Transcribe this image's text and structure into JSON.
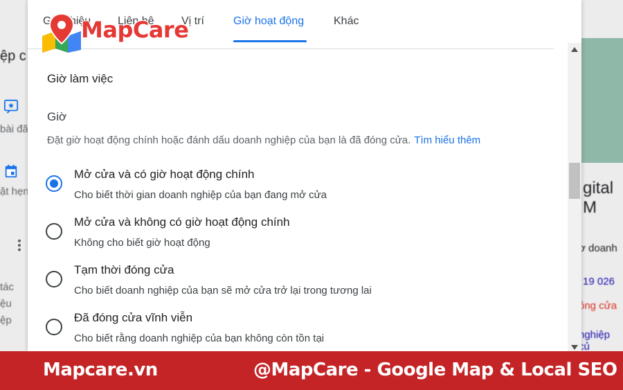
{
  "background_page": {
    "heading": "ệp c",
    "item_1": "bài đă",
    "item_2": "ặt hẹn",
    "item_3": "tác\nệu\nệp",
    "right_title": "gital M",
    "right_line_1": "ơ doanh",
    "right_phone": "19 026",
    "right_status": "ông cửa",
    "right_link": "nghiệp củ"
  },
  "brand": {
    "logo_text": "MapCare",
    "accent_color": "#e53935"
  },
  "dialog": {
    "tabs": [
      {
        "label": "Giới thiệu",
        "active": false
      },
      {
        "label": "Liên hệ",
        "active": false
      },
      {
        "label": "Vị trí",
        "active": false
      },
      {
        "label": "Giờ hoạt động",
        "active": true
      },
      {
        "label": "Khác",
        "active": false
      }
    ],
    "section_title": "Giờ làm việc",
    "hours_label": "Giờ",
    "description": "Đặt giờ hoạt động chính hoặc đánh dấu doanh nghiệp của bạn là đã đóng cửa.",
    "learn_more": "Tìm hiểu thêm",
    "options": [
      {
        "title": "Mở cửa và có giờ hoạt động chính",
        "subtitle": "Cho biết thời gian doanh nghiệp của bạn đang mở cửa",
        "checked": true
      },
      {
        "title": "Mở cửa và không có giờ hoạt động chính",
        "subtitle": "Không cho biết giờ hoạt động",
        "checked": false
      },
      {
        "title": "Tạm thời đóng cửa",
        "subtitle": "Cho biết doanh nghiệp của bạn sẽ mở cửa trở lại trong tương lai",
        "checked": false
      },
      {
        "title": "Đã đóng cửa vĩnh viễn",
        "subtitle": "Cho biết rằng doanh nghiệp của bạn không còn tồn tại",
        "checked": false
      }
    ],
    "accent_color": "#1a73e8"
  },
  "footer": {
    "left": "Mapcare.vn",
    "right": "@MapCare - Google Map & Local SEO",
    "background_color": "#c42426"
  }
}
